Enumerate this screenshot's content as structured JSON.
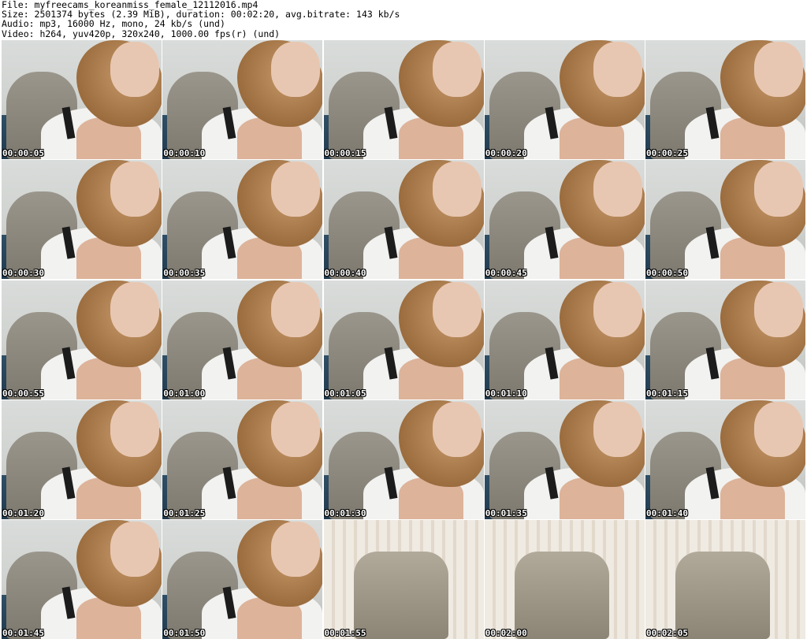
{
  "header": {
    "file_line": "File: myfreecams_koreanmiss_female_12112016.mp4",
    "size_line": "Size: 2501374 bytes (2.39 MiB), duration: 00:02:20, avg.bitrate: 143 kb/s",
    "audio_line": "Audio: mp3, 16000 Hz, mono, 24 kb/s (und)",
    "video_line": "Video: h264, yuv420p, 320x240, 1000.00 fps(r) (und)"
  },
  "thumbnails": [
    {
      "ts": "00:00:05"
    },
    {
      "ts": "00:00:10"
    },
    {
      "ts": "00:00:15"
    },
    {
      "ts": "00:00:20"
    },
    {
      "ts": "00:00:25"
    },
    {
      "ts": "00:00:30"
    },
    {
      "ts": "00:00:35"
    },
    {
      "ts": "00:00:40"
    },
    {
      "ts": "00:00:45"
    },
    {
      "ts": "00:00:50"
    },
    {
      "ts": "00:00:55"
    },
    {
      "ts": "00:01:00"
    },
    {
      "ts": "00:01:05"
    },
    {
      "ts": "00:01:10"
    },
    {
      "ts": "00:01:15"
    },
    {
      "ts": "00:01:20"
    },
    {
      "ts": "00:01:25"
    },
    {
      "ts": "00:01:30"
    },
    {
      "ts": "00:01:35"
    },
    {
      "ts": "00:01:40"
    },
    {
      "ts": "00:01:45"
    },
    {
      "ts": "00:01:50"
    },
    {
      "ts": "00:01:55"
    },
    {
      "ts": "00:02:00"
    },
    {
      "ts": "00:02:05"
    }
  ]
}
